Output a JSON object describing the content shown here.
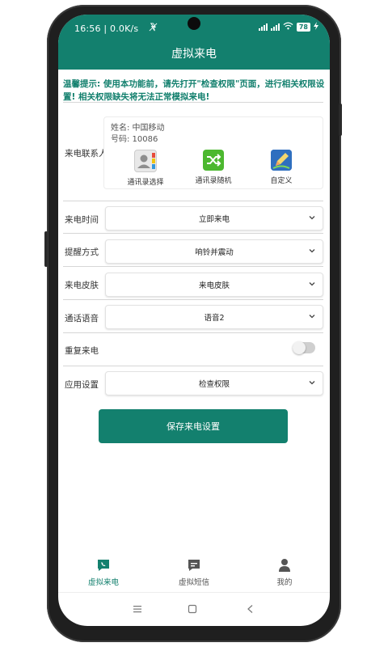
{
  "status_bar": {
    "time_speed": "16:56 | 0.0K/s",
    "battery": "78"
  },
  "header": {
    "title": "虚拟来电"
  },
  "notice": "温馨提示: 使用本功能前，请先打开\"检查权限\"页面，进行相关权限设置! 相关权限缺失将无法正常模拟来电!",
  "contact": {
    "label": "来电联系人",
    "name": "姓名: 中国移动",
    "number": "号码: 10086",
    "options": [
      {
        "label": "通讯录选择",
        "icon": "contacts-book-icon"
      },
      {
        "label": "通讯录随机",
        "icon": "shuffle-icon"
      },
      {
        "label": "自定义",
        "icon": "edit-pen-icon"
      }
    ]
  },
  "settings": {
    "call_time": {
      "label": "来电时间",
      "value": "立即来电"
    },
    "reminder": {
      "label": "提醒方式",
      "value": "响铃并震动"
    },
    "skin": {
      "label": "来电皮肤",
      "value": "来电皮肤"
    },
    "voice": {
      "label": "通话语音",
      "value": "语音2"
    },
    "repeat": {
      "label": "重复来电",
      "enabled": false
    },
    "app_settings": {
      "label": "应用设置",
      "value": "检查权限"
    }
  },
  "save_button": "保存来电设置",
  "tabs": [
    {
      "label": "虚拟来电",
      "active": true,
      "icon": "phone-chat-icon"
    },
    {
      "label": "虚拟短信",
      "active": false,
      "icon": "message-icon"
    },
    {
      "label": "我的",
      "active": false,
      "icon": "user-icon"
    }
  ],
  "colors": {
    "primary": "#13806e",
    "inactive": "#555555"
  }
}
